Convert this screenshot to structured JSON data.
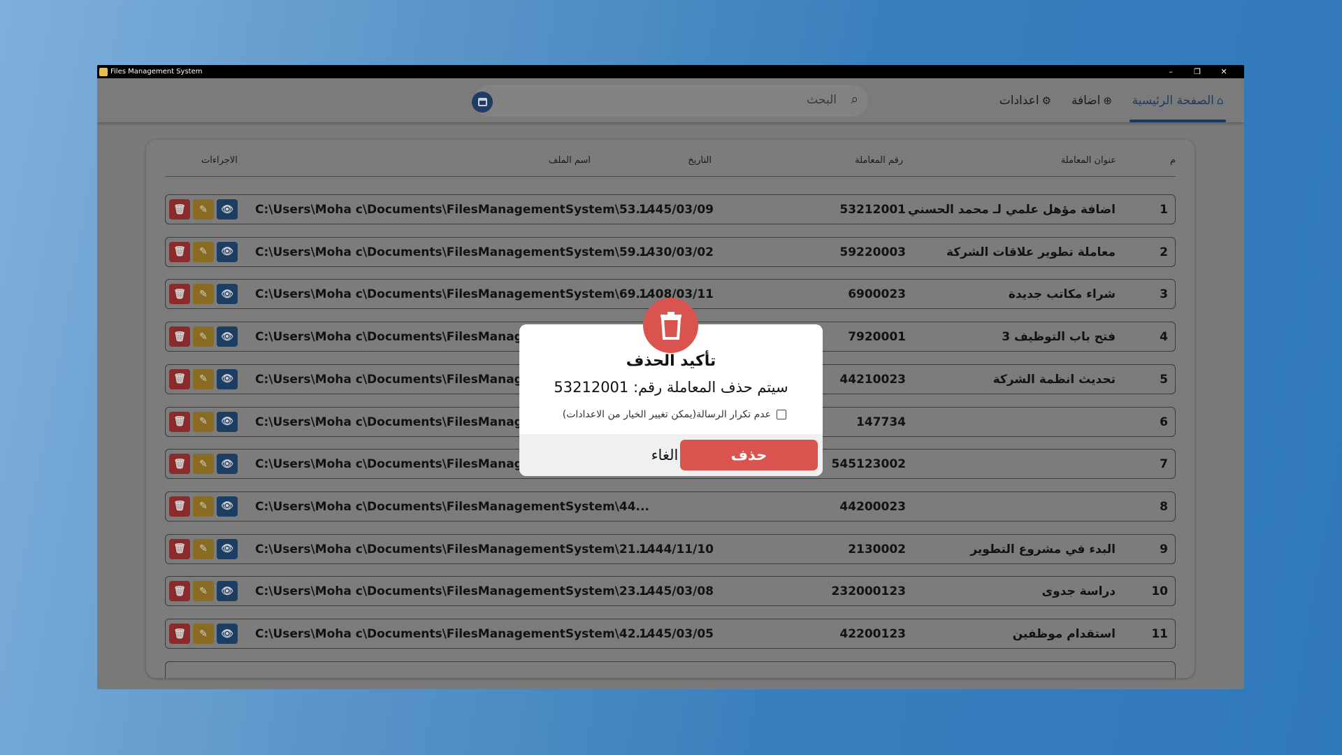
{
  "window": {
    "title": "Files Management System"
  },
  "titlebar_controls": {
    "minimize": "–",
    "restore": "❐",
    "close": "✕"
  },
  "nav": {
    "home_label": "الصفحة الرئيسية",
    "add_label": "اضافة",
    "settings_label": "اعدادات"
  },
  "search": {
    "placeholder": "البحث"
  },
  "table": {
    "headers": {
      "index": "م",
      "title": "عنوان المعاملة",
      "txn_number": "رقم المعاملة",
      "date": "التاريخ",
      "file_name": "اسم الملف",
      "actions": "الاجراءات"
    },
    "rows": [
      {
        "index": "1",
        "title": "اضافة مؤهل علمي لـ محمد الحسني",
        "txn_number": "53212001",
        "date": "1445/03/09",
        "file_name": "C:\\Users\\Moha c\\Documents\\FilesManagementSystem\\53..."
      },
      {
        "index": "2",
        "title": "معاملة تطوير علاقات الشركة",
        "txn_number": "59220003",
        "date": "1430/03/02",
        "file_name": "C:\\Users\\Moha c\\Documents\\FilesManagementSystem\\59..."
      },
      {
        "index": "3",
        "title": "شراء مكاتب جديدة",
        "txn_number": "6900023",
        "date": "1408/03/11",
        "file_name": "C:\\Users\\Moha c\\Documents\\FilesManagementSystem\\69..."
      },
      {
        "index": "4",
        "title": "فتح باب التوظيف 3",
        "txn_number": "7920001",
        "date": "",
        "file_name": "C:\\Users\\Moha c\\Documents\\FilesManagement"
      },
      {
        "index": "5",
        "title": "تحديث انظمة الشركة",
        "txn_number": "44210023",
        "date": "",
        "file_name": "C:\\Users\\Moha c\\Documents\\FilesManagement"
      },
      {
        "index": "6",
        "title": "",
        "txn_number": "147734",
        "date": "",
        "file_name": "C:\\Users\\Moha c\\Documents\\FilesManagement"
      },
      {
        "index": "7",
        "title": "",
        "txn_number": "545123002",
        "date": "",
        "file_name": "C:\\Users\\Moha c\\Documents\\FilesManagement"
      },
      {
        "index": "8",
        "title": "",
        "txn_number": "44200023",
        "date": "",
        "file_name": "C:\\Users\\Moha c\\Documents\\FilesManagementSystem\\44..."
      },
      {
        "index": "9",
        "title": "البدء في مشروع التطوير",
        "txn_number": "2130002",
        "date": "1444/11/10",
        "file_name": "C:\\Users\\Moha c\\Documents\\FilesManagementSystem\\21..."
      },
      {
        "index": "10",
        "title": "دراسة جدوى",
        "txn_number": "232000123",
        "date": "1445/03/08",
        "file_name": "C:\\Users\\Moha c\\Documents\\FilesManagementSystem\\23..."
      },
      {
        "index": "11",
        "title": "استقدام موظفين",
        "txn_number": "42200123",
        "date": "1445/03/05",
        "file_name": "C:\\Users\\Moha c\\Documents\\FilesManagementSystem\\42..."
      }
    ]
  },
  "dialog": {
    "title": "تأكيد الحذف",
    "message": "سيتم حذف المعاملة رقم: 53212001",
    "checkbox_label": "عدم تكرار الرسالة(يمكن تغيير الخيار من الاعدادات)",
    "delete_label": "حذف",
    "cancel_label": "الغاء"
  },
  "colors": {
    "accent": "#1e3a63",
    "danger": "#d9534f",
    "edit": "#c8962e",
    "view": "#2b5a8f"
  }
}
